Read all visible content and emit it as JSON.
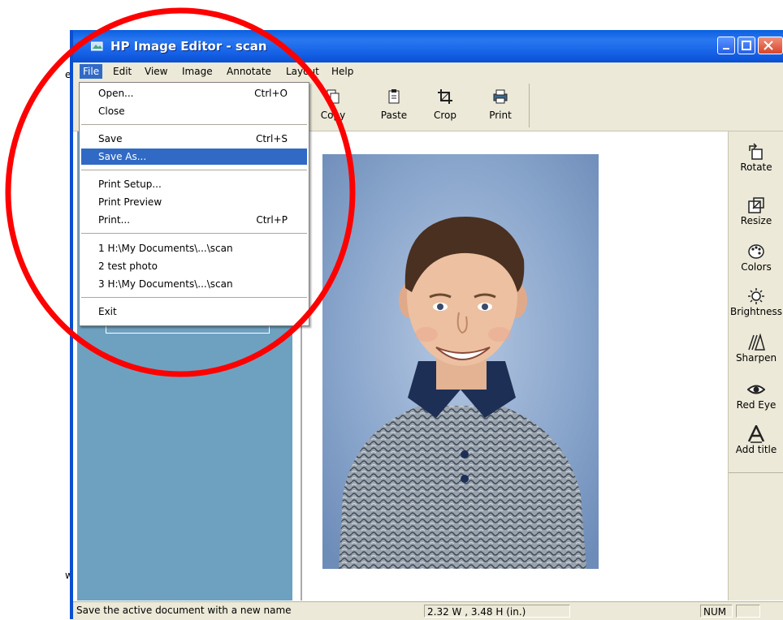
{
  "window": {
    "title": "HP Image Editor - scan",
    "controls": [
      "minimize",
      "maximize",
      "close"
    ]
  },
  "left_strip": {
    "top_char": "e",
    "bottom_char": "w"
  },
  "menubar": {
    "items": [
      "File",
      "Edit",
      "View",
      "Image",
      "Annotate",
      "Layout",
      "Help"
    ],
    "active": "File"
  },
  "toolbar": {
    "buttons": [
      {
        "label": "Copy",
        "icon": "copy-icon"
      },
      {
        "label": "Paste",
        "icon": "paste-icon"
      },
      {
        "label": "Crop",
        "icon": "crop-icon"
      },
      {
        "label": "Print",
        "icon": "print-icon"
      }
    ]
  },
  "file_menu": {
    "groups": [
      [
        {
          "label": "Open...",
          "shortcut": "Ctrl+O"
        },
        {
          "label": "Close",
          "shortcut": ""
        }
      ],
      [
        {
          "label": "Save",
          "shortcut": "Ctrl+S"
        },
        {
          "label": "Save As...",
          "shortcut": "",
          "highlighted": true
        }
      ],
      [
        {
          "label": "Print Setup...",
          "shortcut": ""
        },
        {
          "label": "Print Preview",
          "shortcut": ""
        },
        {
          "label": "Print...",
          "shortcut": "Ctrl+P"
        }
      ],
      [
        {
          "label": "1 H:\\My Documents\\...\\scan",
          "shortcut": ""
        },
        {
          "label": "2 test photo",
          "shortcut": ""
        },
        {
          "label": "3 H:\\My Documents\\...\\scan",
          "shortcut": ""
        }
      ],
      [
        {
          "label": "Exit",
          "shortcut": ""
        }
      ]
    ]
  },
  "right_tools": [
    {
      "label": "Rotate",
      "icon": "rotate-icon"
    },
    {
      "label": "Resize",
      "icon": "resize-icon"
    },
    {
      "label": "Colors",
      "icon": "palette-icon"
    },
    {
      "label": "Brightness",
      "icon": "brightness-icon"
    },
    {
      "label": "Sharpen",
      "icon": "sharpen-icon"
    },
    {
      "label": "Red Eye",
      "icon": "eye-icon"
    },
    {
      "label": "Add title",
      "icon": "add-title-icon"
    }
  ],
  "statusbar": {
    "message": "Save the active document with a new name",
    "dimensions": "2.32 W , 3.48 H  (in.)",
    "num_indicator": "NUM"
  },
  "photo": {
    "subject": "school portrait of a smiling boy",
    "background_color": "#8aa6cc"
  },
  "annotation": {
    "shape": "red circle around File menu",
    "color": "#ff0000"
  },
  "colors": {
    "titlebar": "#1662e8",
    "menu_highlight": "#316ac5",
    "pane": "#6ea1c0",
    "chrome": "#ece9d8"
  }
}
